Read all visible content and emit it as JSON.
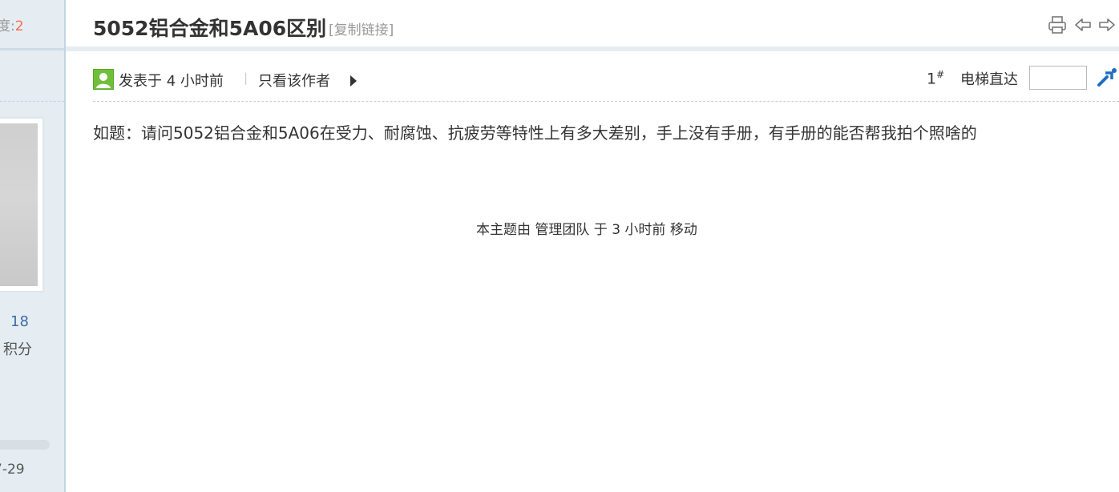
{
  "sidebar": {
    "stat_top_label": "度:",
    "stat_top_value": "2",
    "score_value": "18",
    "score_label": "积分",
    "date_fragment": "7-29"
  },
  "thread": {
    "title": "5052铝合金和5A06区别",
    "copy_link": "[复制链接]",
    "icons": [
      "print-icon",
      "previous-thread-icon",
      "next-thread-icon"
    ]
  },
  "post": {
    "posted_time": "发表于 4 小时前",
    "separator": "|",
    "only_author": "只看该作者",
    "floor": "1",
    "floor_mark": "#",
    "goto_label": "电梯直达",
    "goto_placeholder": "",
    "content": "如题：请问5052铝合金和5A06在受力、耐腐蚀、抗疲劳等特性上有多大差别，手上没有手册，有手册的能否帮我拍个照啥的",
    "moved_note": "本主题由 管理团队 于 3 小时前 移动"
  },
  "colors": {
    "sidebar_bg": "#e5edf2",
    "accent_number": "#f26c4f",
    "link_blue": "#3b6ea5",
    "user_icon_green": "#6fbf3a"
  }
}
